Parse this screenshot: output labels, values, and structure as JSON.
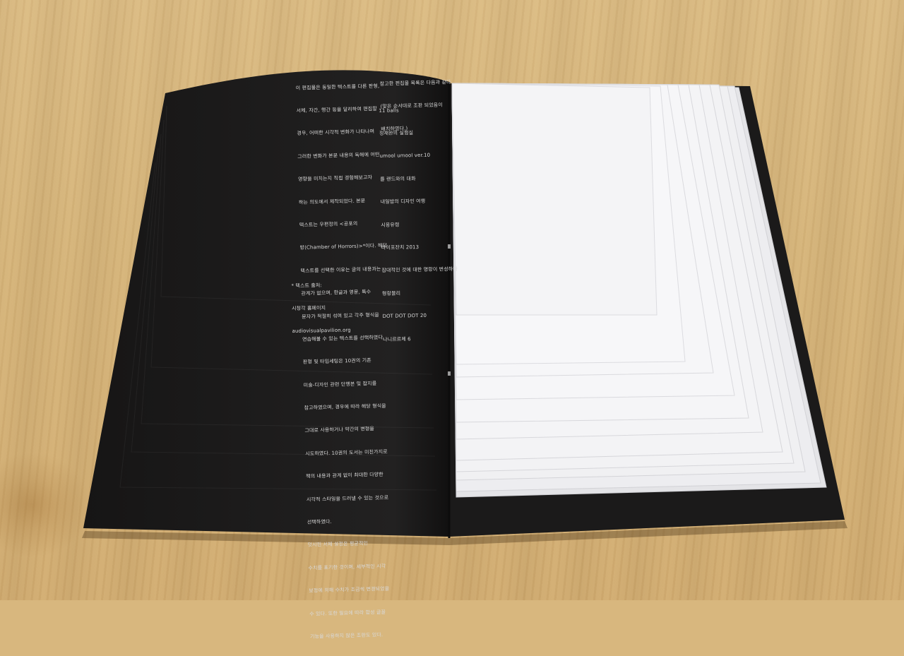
{
  "left_page": {
    "body_lines": [
      "이 편집물은 동일한 텍스트를 다른 판형,",
      "서체, 자간, 행간 등을 달리하여 편집할",
      "경우, 어떠한 시각적 변화가 나타나며",
      "그러한 변화가 본문 내용의 독해에 어떤",
      "영향을 미치는지 직접 경험해보고자",
      "하는 의도에서 제작되었다. 본문",
      "텍스트는 우편정의 <공포의",
      "방(Chamber of Horrors)>*이다. 해당",
      "텍스트를 선택한 이유는 글의 내용과는",
      "관계가 없으며, 한글과 영문, 특수",
      "문자가 적절히 섞여 있고 각주 형식을",
      "연습해볼 수 있는 텍스트를 선택하였다.",
      "판형 및 타입세팅은 10권의 기존",
      "미술-디자인 관련 단행본 및 잡지를",
      "참고하였으며, 경우에 따라 해당 형식을",
      "그대로 사용하거나 약간의 변형을",
      "시도하였다. 10권의 도서는 미친가지로",
      "책의 내용과 관계 없이 최대한 다양한",
      "시각적 스타일을 드러낼 수 있는 것으로",
      "선택하였다.",
      "덧시된 서체 설정은 평균적인",
      "수치를 표기한 것이며, 세부적인 시각",
      "보정에 의해 수치가 조금씩 변경되었을",
      "수 있다. 또한 필요에 따라 합성 글꼴",
      "기능을 사용하지 않은 조판도 있다."
    ],
    "source_lines": [
      "* 텍스트 출처:",
      "시청각 홈페이지",
      "audiovisualpavilion.org"
    ]
  },
  "right_page": {
    "intro_lines": [
      "참고한 편집물 목록은 다음과 같다.",
      "(맞은 순서대로 조판 되었음이",
      "배치하였다.)"
    ],
    "list_lines": [
      "11 balls",
      "정재완의 실험실",
      "umool umool ver.10",
      "를 랜드와의 대화",
      "내일밤의 디자인 여행",
      "시몽유령",
      "타이포잔치 2013",
      "잡대적인 것에 대한 명랑이 변성하다",
      "형랑블리",
      "DOT DOT DOT 20",
      "나니르르체 6"
    ]
  },
  "colors": {
    "wood": "#d6b57b",
    "cover": "#1b1a1a",
    "left_page": "#1f1e1e",
    "paper": "#f2f2f4",
    "text": "#d9d9d9"
  }
}
